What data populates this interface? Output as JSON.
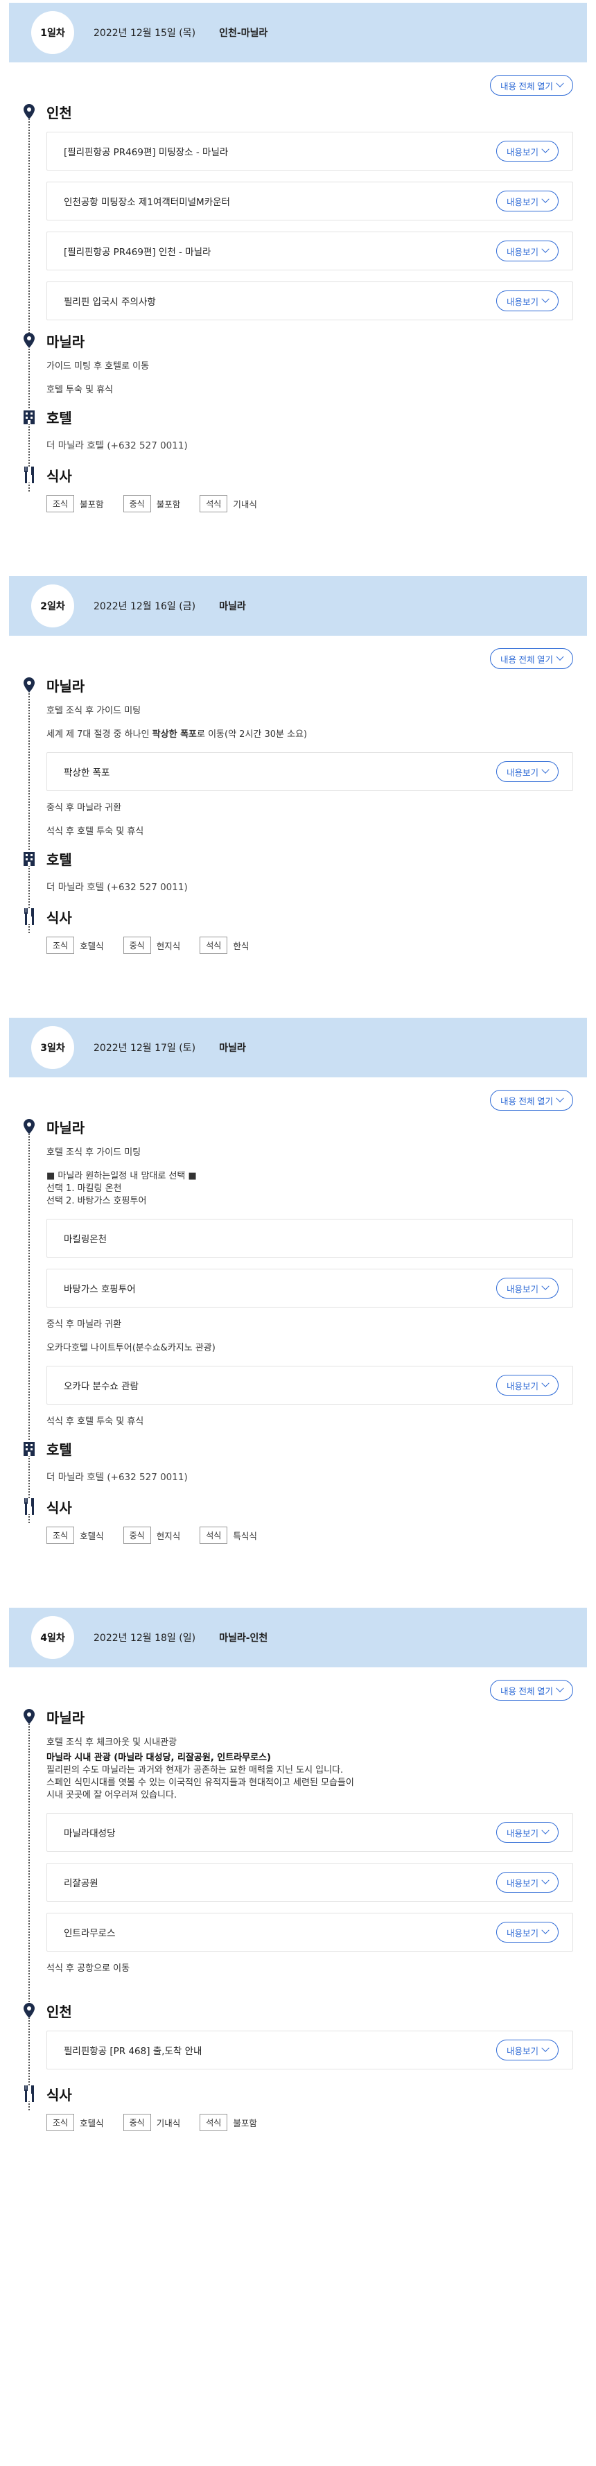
{
  "common": {
    "expand_all": "내용 전체 열기",
    "view_more": "내용보기",
    "meal_labels": {
      "breakfast": "조식",
      "lunch": "중식",
      "dinner": "석식"
    },
    "hotel_title": "호텔",
    "meal_title": "식사"
  },
  "days": [
    {
      "badge": "1일차",
      "date": "2022년 12월 15일 (목)",
      "route": "인천-마닐라",
      "incheon_title": "인천",
      "cards": [
        "[필리핀항공 PR469편] 미팅장소 - 마닐라",
        "인천공항 미팅장소 제1여객터미널M카운터",
        "[필리핀항공 PR469편] 인천 - 마닐라",
        "필리핀 입국시 주의사항"
      ],
      "manila_title": "마닐라",
      "manila_lines": [
        "가이드 미팅 후 호텔로 이동",
        "호텔 투숙 및 휴식"
      ],
      "hotel": "더 마닐라 호텔 (+632 527 0011)",
      "meals": {
        "breakfast": "불포함",
        "lunch": "불포함",
        "dinner": "기내식"
      }
    },
    {
      "badge": "2일차",
      "date": "2022년 12월 16일 (금)",
      "route": "마닐라",
      "manila_title": "마닐라",
      "line1": "호텔 조식 후 가이드 미팅",
      "line2_pre": "세계 제 7대 절경 중 하나인 ",
      "line2_bold": "팍상한 폭포",
      "line2_post": "로 이동(약 2시간 30분 소요)",
      "card": "팍상한 폭포",
      "line3": "중식 후 마닐라 귀환",
      "line4": "석식 후 호텔 투숙 및 휴식",
      "hotel": "더 마닐라 호텔 (+632 527 0011)",
      "meals": {
        "breakfast": "호텔식",
        "lunch": "현지식",
        "dinner": "한식"
      }
    },
    {
      "badge": "3일차",
      "date": "2022년 12월 17일 (토)",
      "route": "마닐라",
      "manila_title": "마닐라",
      "line1": "호텔 조식 후 가이드 미팅",
      "choice_head": "■ 마닐라 원하는일정 내 맘대로 선택 ■",
      "choice1": "선택 1. 마킬링 온천",
      "choice2": "선택 2. 바탕가스 호핑투어",
      "card1": "마킬링온천",
      "card2": "바탕가스 호핑투어",
      "line2": "중식 후 마닐라 귀환",
      "line3": "오카다호텔 나이트투어(분수쇼&카지노 관광)",
      "card3": "오카다 분수쇼 관람",
      "line4": "석식 후 호텔 투숙 및 휴식",
      "hotel": "더 마닐라 호텔 (+632 527 0011)",
      "meals": {
        "breakfast": "호텔식",
        "lunch": "현지식",
        "dinner": "특식식"
      }
    },
    {
      "badge": "4일차",
      "date": "2022년 12월 18일 (일)",
      "route": "마닐라-인천",
      "manila_title": "마닐라",
      "line1": "호텔 조식 후 체크아웃 및 시내관광",
      "bold_line": "마닐라 시내 관광 (마닐라 대성당, 리잘공원, 인트라무로스)",
      "desc1": "필리핀의 수도 마닐라는 과거와 현재가 공존하는 묘한 매력을 지닌 도시 입니다.",
      "desc2": "스페인 식민시대를 엿볼 수 있는 이국적인 유적지들과 현대적이고 세련된 모습들이",
      "desc3": "시내 곳곳에 잘 어우러져 있습니다.",
      "cards": [
        "마닐라대성당",
        "리잘공원",
        "인트라무로스"
      ],
      "line2": "석식 후 공항으로 이동",
      "incheon_title": "인천",
      "incheon_card": "필리핀항공 [PR 468] 출,도착 안내",
      "meals": {
        "breakfast": "호텔식",
        "lunch": "기내식",
        "dinner": "불포함"
      }
    }
  ],
  "icons": {
    "pin": "map-pin-icon",
    "hotel": "hotel-building-icon",
    "meal": "fork-knife-icon",
    "chevron": "chevron-down-icon"
  },
  "colors": {
    "header_bg": "#cadff3",
    "accent": "#2f6bd6",
    "icon": "#1c2b4a"
  }
}
